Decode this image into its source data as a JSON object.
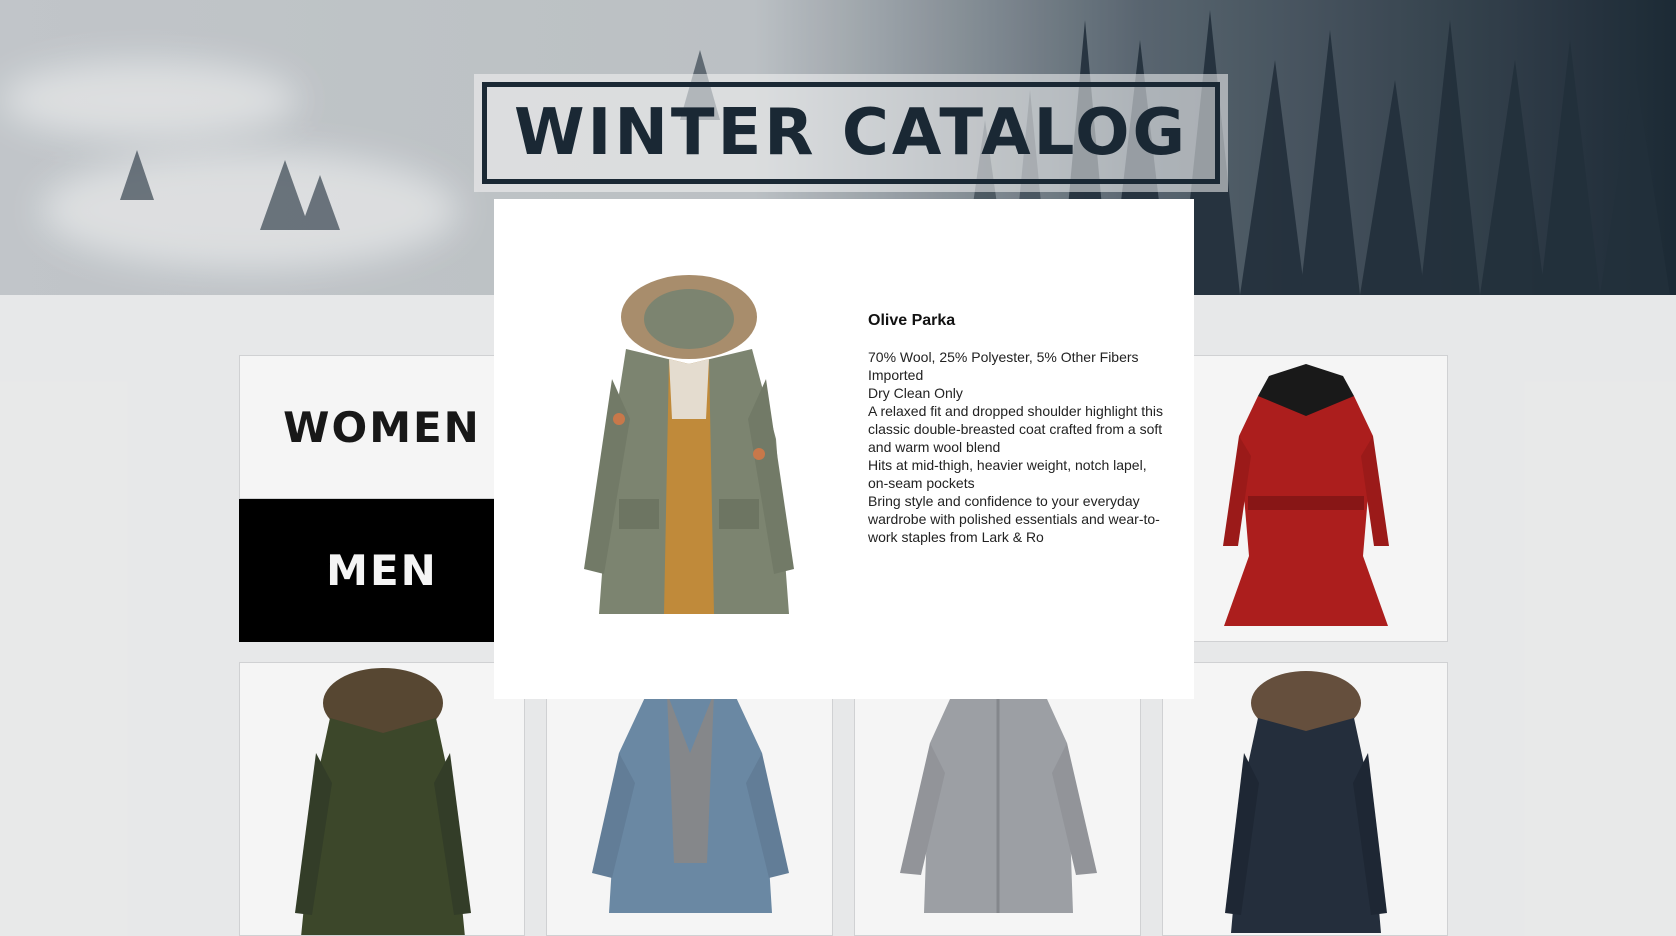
{
  "hero": {
    "title": "WINTER CATALOG"
  },
  "categories": {
    "women": "WOMEN",
    "men": "MEN"
  },
  "modal": {
    "product_name": "Olive Parka",
    "description": [
      "70% Wool, 25% Polyester, 5% Other Fibers",
      "Imported",
      "Dry Clean Only",
      "A relaxed fit and dropped shoulder highlight this classic double-breasted coat crafted from a soft and warm wool blend",
      "Hits at mid-thigh, heavier weight, notch lapel, on-seam pockets",
      "Bring style and confidence to your everyday wardrobe with polished essentials and wear-to-work staples from Lark & Ro"
    ]
  },
  "colors": {
    "title_navy": "#1c2a37",
    "coat_olive": "#7c8470",
    "coat_red": "#b3201f",
    "coat_dark_olive": "#3f4a2c",
    "coat_denim": "#6f8eaa",
    "coat_grey": "#a3a6ab",
    "coat_navy": "#26303f"
  },
  "products": [
    {
      "name": "red-coat"
    },
    {
      "name": "dark-olive-parka"
    },
    {
      "name": "denim-jacket"
    },
    {
      "name": "grey-jacket"
    },
    {
      "name": "navy-parka"
    }
  ]
}
